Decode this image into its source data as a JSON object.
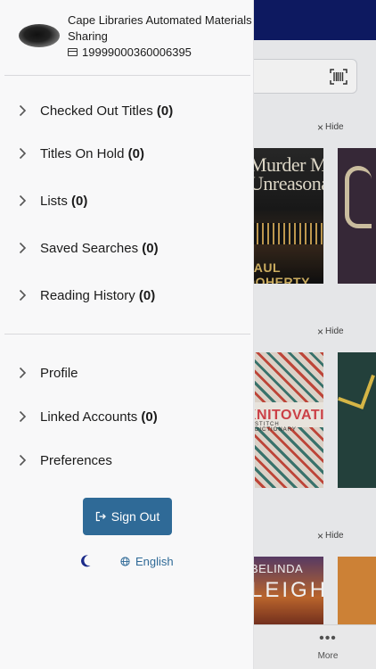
{
  "account": {
    "name": "Cape Libraries Automated Materials Sharing",
    "card_number": "19999000360006395"
  },
  "menu_primary": [
    {
      "label": "Checked Out Titles",
      "count": "(0)"
    },
    {
      "label": "Titles On Hold",
      "count": "(0)"
    },
    {
      "label": "Lists",
      "count": "(0)"
    },
    {
      "label": "Saved Searches",
      "count": "(0)"
    },
    {
      "label": "Reading History",
      "count": "(0)"
    }
  ],
  "menu_secondary": [
    {
      "label": "Profile",
      "count": ""
    },
    {
      "label": "Linked Accounts",
      "count": "(0)"
    },
    {
      "label": "Preferences",
      "count": ""
    }
  ],
  "sign_out_label": "Sign Out",
  "language_label": "English",
  "icons": {
    "menu_chevron": "chevron-right-icon",
    "sign_out": "sign-out-icon",
    "theme": "moon-icon",
    "language": "globe-icon",
    "card": "card-icon",
    "scan": "barcode-icon"
  },
  "background": {
    "hide_label": "Hide",
    "more_label": "More",
    "covers": {
      "c1_title": "Murder Most Unreasonable",
      "c1_author": "PAUL DOHERTY",
      "c3_title": "KNITOVATION",
      "c3_subtitle": "STITCH DICTIONARY",
      "c5_author": "BELINDA",
      "c5_title": "LEIGH"
    }
  },
  "colors": {
    "top_bar": "#0e1b66",
    "accent": "#2f6a97",
    "drawer_bg": "#f8f8f9",
    "text": "#1b1b1b"
  }
}
